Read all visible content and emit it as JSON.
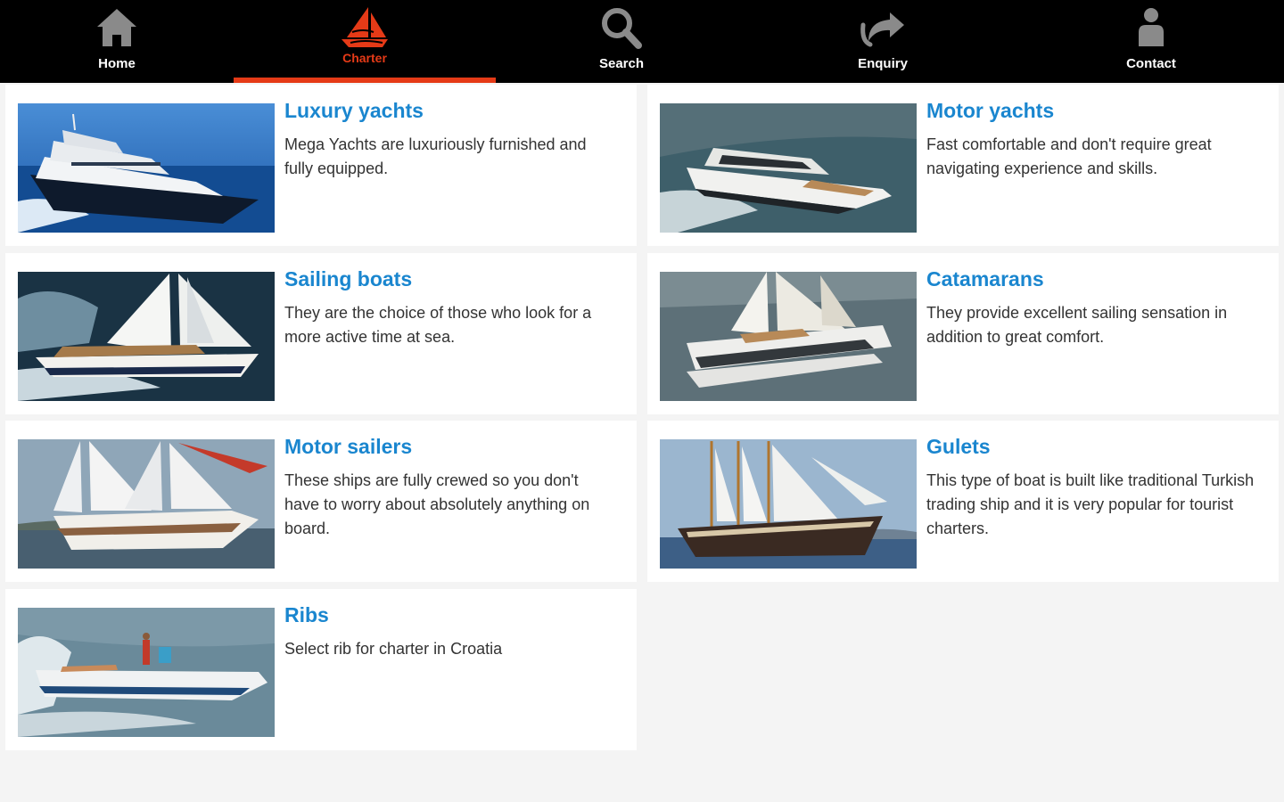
{
  "nav": {
    "items": [
      {
        "label": "Home",
        "icon": "home-icon"
      },
      {
        "label": "Charter",
        "icon": "sailboat-icon",
        "active": true
      },
      {
        "label": "Search",
        "icon": "search-icon"
      },
      {
        "label": "Enquiry",
        "icon": "share-arrow-icon"
      },
      {
        "label": "Contact",
        "icon": "person-icon"
      }
    ],
    "active_color": "#e53a17"
  },
  "categories": [
    {
      "title": "Luxury yachts",
      "desc": "Mega Yachts are luxuriously furnished and fully equipped."
    },
    {
      "title": "Motor yachts",
      "desc": "Fast comfortable and don't require great navigating experience and skills."
    },
    {
      "title": "Sailing boats",
      "desc": "They are the choice of those who look for a more active time at sea."
    },
    {
      "title": "Catamarans",
      "desc": "They provide excellent sailing sensation in addition to great comfort."
    },
    {
      "title": "Motor sailers",
      "desc": "These ships are fully crewed so you don't have to worry about absolutely anything on board."
    },
    {
      "title": "Gulets",
      "desc": "This type of boat is built like traditional Turkish trading ship and it is very popular for tourist charters."
    },
    {
      "title": "Ribs",
      "desc": "Select rib for charter in Croatia"
    }
  ],
  "colors": {
    "title": "#1a86cf",
    "nav_bg": "#000000",
    "page_bg": "#f4f4f4"
  }
}
